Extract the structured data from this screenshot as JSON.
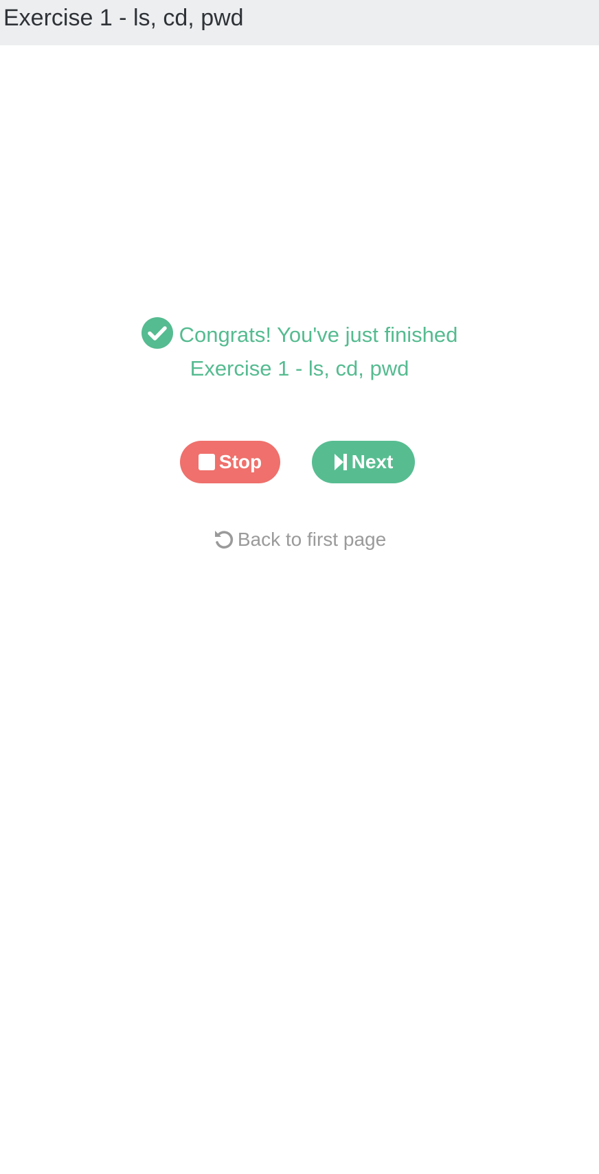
{
  "header": {
    "title": "Exercise 1 - ls, cd, pwd"
  },
  "congrats": {
    "line1": "Congrats! You've just finished",
    "line2": "Exercise 1 - ls, cd, pwd",
    "icon": "check-circle-icon"
  },
  "buttons": {
    "stop_label": "Stop",
    "stop_icon": "stop-icon",
    "next_label": "Next",
    "next_icon": "step-forward-icon"
  },
  "back_link": {
    "label": "Back to first page",
    "icon": "undo-icon"
  },
  "colors": {
    "header_bg": "#eceef0",
    "success": "#55bb90",
    "stop": "#ef706c",
    "next": "#57bd91",
    "muted": "#9a9a9a"
  }
}
